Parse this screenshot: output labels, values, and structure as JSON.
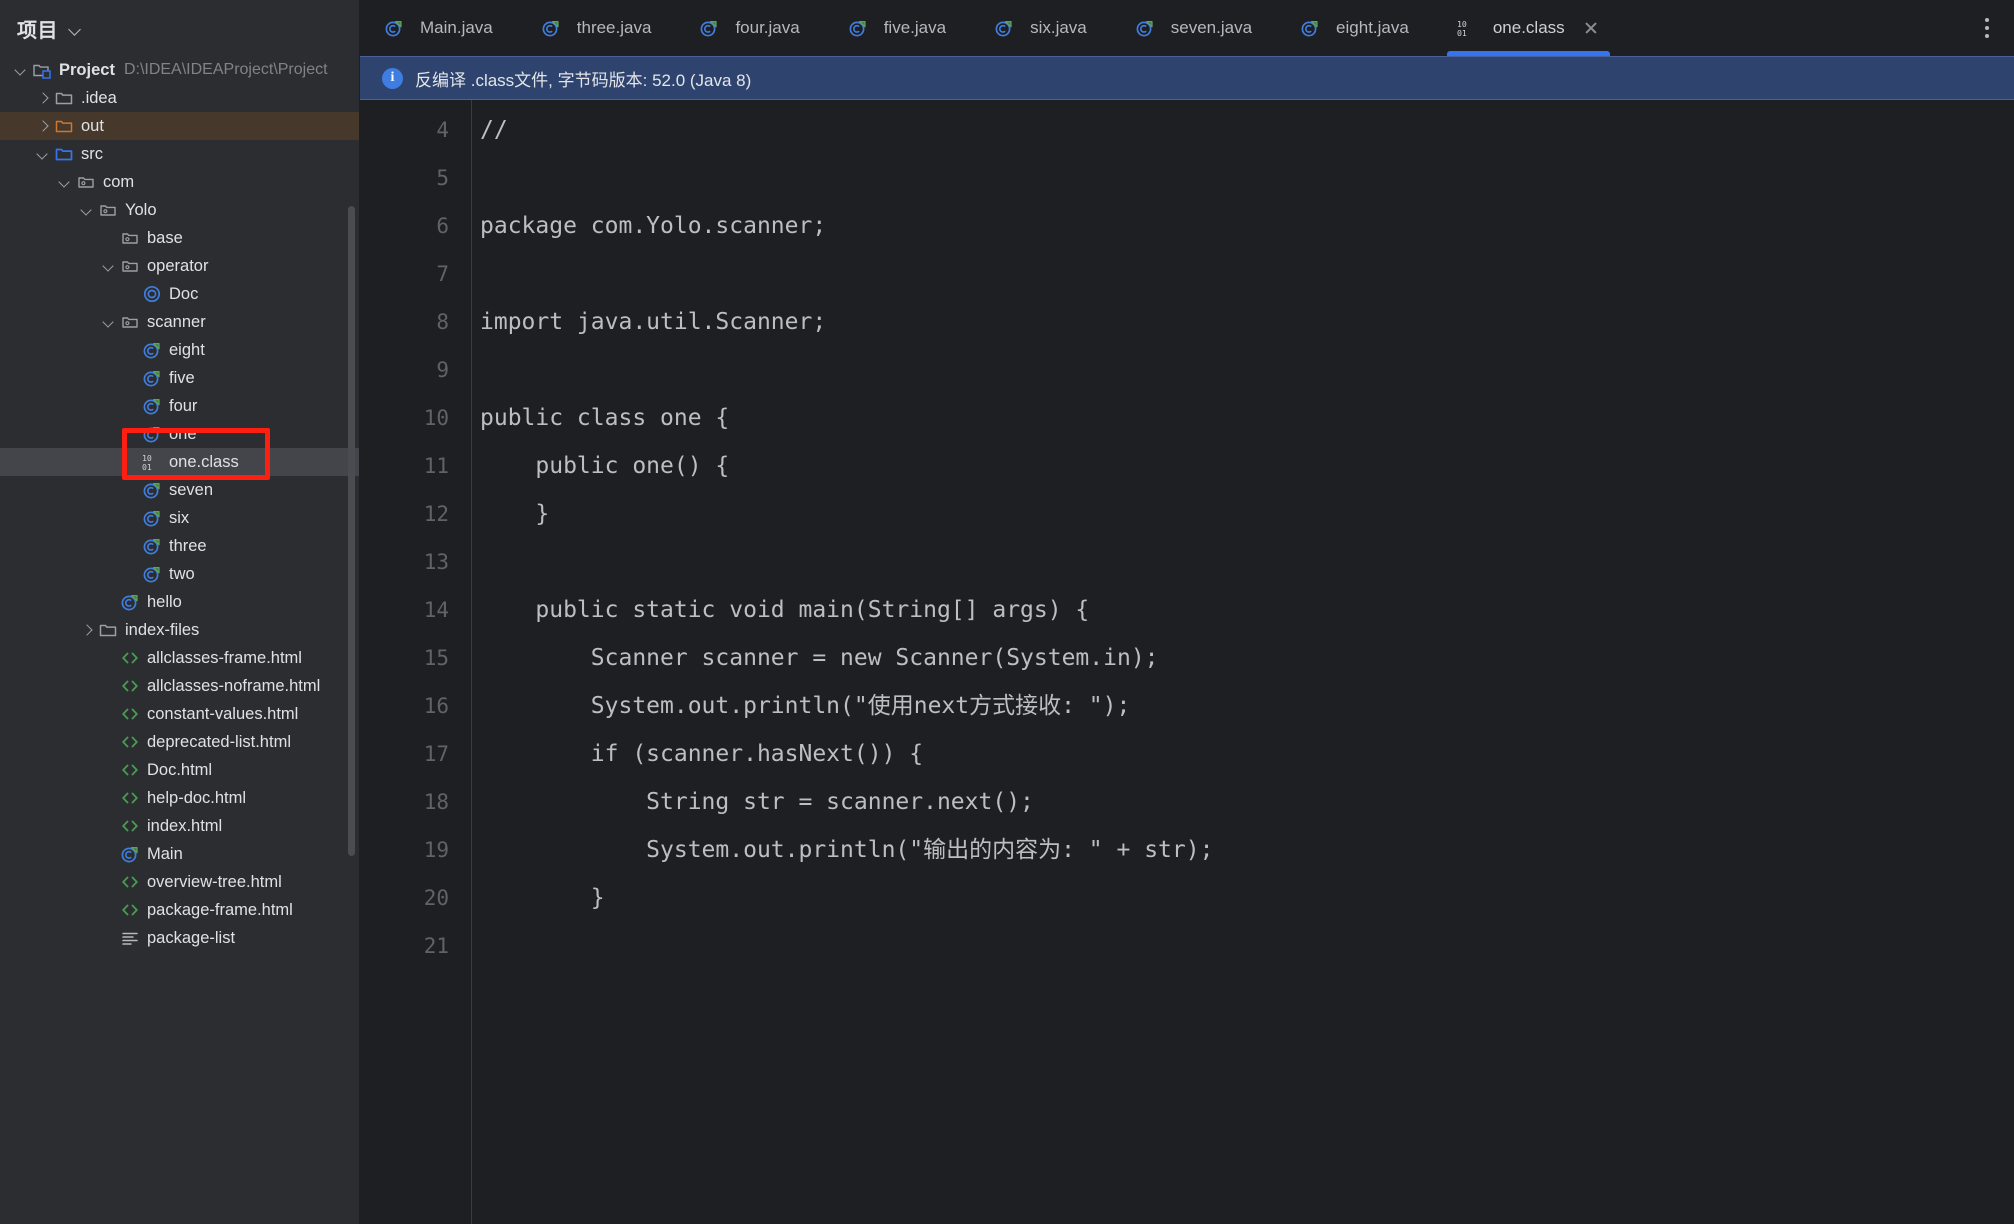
{
  "sidebar": {
    "title": "项目",
    "tree": [
      {
        "depth": 0,
        "twisty": "down",
        "icon": "project-folder-icon",
        "label": "Project",
        "bold": true,
        "sub": "D:\\IDEA\\IDEAProject\\Project",
        "sel": "none"
      },
      {
        "depth": 1,
        "twisty": "right",
        "icon": "folder-icon",
        "label": ".idea",
        "bold": false,
        "sub": "",
        "sel": "none"
      },
      {
        "depth": 1,
        "twisty": "right",
        "icon": "folder-orange-icon",
        "label": "out",
        "bold": false,
        "sub": "",
        "sel": "orange"
      },
      {
        "depth": 1,
        "twisty": "down",
        "icon": "folder-blue-icon",
        "label": "src",
        "bold": false,
        "sub": "",
        "sel": "none"
      },
      {
        "depth": 2,
        "twisty": "down",
        "icon": "package-folder-icon",
        "label": "com",
        "bold": false,
        "sub": "",
        "sel": "none"
      },
      {
        "depth": 3,
        "twisty": "down",
        "icon": "package-folder-icon",
        "label": "Yolo",
        "bold": false,
        "sub": "",
        "sel": "none"
      },
      {
        "depth": 4,
        "twisty": "none",
        "icon": "package-folder-icon",
        "label": "base",
        "bold": false,
        "sub": "",
        "sel": "none"
      },
      {
        "depth": 4,
        "twisty": "down",
        "icon": "package-folder-icon",
        "label": "operator",
        "bold": false,
        "sub": "",
        "sel": "none"
      },
      {
        "depth": 5,
        "twisty": "none",
        "icon": "java-class-icon",
        "label": "Doc",
        "bold": false,
        "sub": "",
        "sel": "none"
      },
      {
        "depth": 4,
        "twisty": "down",
        "icon": "package-folder-icon",
        "label": "scanner",
        "bold": false,
        "sub": "",
        "sel": "none"
      },
      {
        "depth": 5,
        "twisty": "none",
        "icon": "java-runnable-class-icon",
        "label": "eight",
        "bold": false,
        "sub": "",
        "sel": "none"
      },
      {
        "depth": 5,
        "twisty": "none",
        "icon": "java-runnable-class-icon",
        "label": "five",
        "bold": false,
        "sub": "",
        "sel": "none"
      },
      {
        "depth": 5,
        "twisty": "none",
        "icon": "java-runnable-class-icon",
        "label": "four",
        "bold": false,
        "sub": "",
        "sel": "none"
      },
      {
        "depth": 5,
        "twisty": "none",
        "icon": "java-runnable-class-icon",
        "label": "one",
        "bold": false,
        "sub": "",
        "sel": "none"
      },
      {
        "depth": 5,
        "twisty": "none",
        "icon": "binary-class-file-icon",
        "label": "one.class",
        "bold": false,
        "sub": "",
        "sel": "gray"
      },
      {
        "depth": 5,
        "twisty": "none",
        "icon": "java-runnable-class-icon",
        "label": "seven",
        "bold": false,
        "sub": "",
        "sel": "none"
      },
      {
        "depth": 5,
        "twisty": "none",
        "icon": "java-runnable-class-icon",
        "label": "six",
        "bold": false,
        "sub": "",
        "sel": "none"
      },
      {
        "depth": 5,
        "twisty": "none",
        "icon": "java-runnable-class-icon",
        "label": "three",
        "bold": false,
        "sub": "",
        "sel": "none"
      },
      {
        "depth": 5,
        "twisty": "none",
        "icon": "java-runnable-class-icon",
        "label": "two",
        "bold": false,
        "sub": "",
        "sel": "none"
      },
      {
        "depth": 4,
        "twisty": "none",
        "icon": "java-runnable-class-icon",
        "label": "hello",
        "bold": false,
        "sub": "",
        "sel": "none"
      },
      {
        "depth": 3,
        "twisty": "right",
        "icon": "folder-icon",
        "label": "index-files",
        "bold": false,
        "sub": "",
        "sel": "none"
      },
      {
        "depth": 4,
        "twisty": "none",
        "icon": "html-file-icon",
        "label": "allclasses-frame.html",
        "bold": false,
        "sub": "",
        "sel": "none"
      },
      {
        "depth": 4,
        "twisty": "none",
        "icon": "html-file-icon",
        "label": "allclasses-noframe.html",
        "bold": false,
        "sub": "",
        "sel": "none"
      },
      {
        "depth": 4,
        "twisty": "none",
        "icon": "html-file-icon",
        "label": "constant-values.html",
        "bold": false,
        "sub": "",
        "sel": "none"
      },
      {
        "depth": 4,
        "twisty": "none",
        "icon": "html-file-icon",
        "label": "deprecated-list.html",
        "bold": false,
        "sub": "",
        "sel": "none"
      },
      {
        "depth": 4,
        "twisty": "none",
        "icon": "html-file-icon",
        "label": "Doc.html",
        "bold": false,
        "sub": "",
        "sel": "none"
      },
      {
        "depth": 4,
        "twisty": "none",
        "icon": "html-file-icon",
        "label": "help-doc.html",
        "bold": false,
        "sub": "",
        "sel": "none"
      },
      {
        "depth": 4,
        "twisty": "none",
        "icon": "html-file-icon",
        "label": "index.html",
        "bold": false,
        "sub": "",
        "sel": "none"
      },
      {
        "depth": 4,
        "twisty": "none",
        "icon": "java-runnable-class-icon",
        "label": "Main",
        "bold": false,
        "sub": "",
        "sel": "none"
      },
      {
        "depth": 4,
        "twisty": "none",
        "icon": "html-file-icon",
        "label": "overview-tree.html",
        "bold": false,
        "sub": "",
        "sel": "none"
      },
      {
        "depth": 4,
        "twisty": "none",
        "icon": "html-file-icon",
        "label": "package-frame.html",
        "bold": false,
        "sub": "",
        "sel": "none"
      },
      {
        "depth": 4,
        "twisty": "none",
        "icon": "text-file-icon",
        "label": "package-list",
        "bold": false,
        "sub": "",
        "sel": "none"
      }
    ]
  },
  "tabs": [
    {
      "label": "Main.java",
      "icon": "java-runnable-class-icon",
      "active": false,
      "closable": false
    },
    {
      "label": "three.java",
      "icon": "java-runnable-class-icon",
      "active": false,
      "closable": false
    },
    {
      "label": "four.java",
      "icon": "java-runnable-class-icon",
      "active": false,
      "closable": false
    },
    {
      "label": "five.java",
      "icon": "java-runnable-class-icon",
      "active": false,
      "closable": false
    },
    {
      "label": "six.java",
      "icon": "java-runnable-class-icon",
      "active": false,
      "closable": false
    },
    {
      "label": "seven.java",
      "icon": "java-runnable-class-icon",
      "active": false,
      "closable": false
    },
    {
      "label": "eight.java",
      "icon": "java-runnable-class-icon",
      "active": false,
      "closable": false
    },
    {
      "label": "one.class",
      "icon": "binary-class-file-icon",
      "active": true,
      "closable": true
    }
  ],
  "notification": {
    "icon": "info-icon",
    "text": "反编译 .class文件, 字节码版本: 52.0 (Java 8)"
  },
  "editor": {
    "lines": [
      {
        "n": "4",
        "text": "//"
      },
      {
        "n": "5",
        "text": ""
      },
      {
        "n": "6",
        "text": "package com.Yolo.scanner;"
      },
      {
        "n": "7",
        "text": ""
      },
      {
        "n": "8",
        "text": "import java.util.Scanner;"
      },
      {
        "n": "9",
        "text": ""
      },
      {
        "n": "10",
        "text": "public class one {"
      },
      {
        "n": "11",
        "text": "    public one() {"
      },
      {
        "n": "12",
        "text": "    }"
      },
      {
        "n": "13",
        "text": ""
      },
      {
        "n": "14",
        "text": "    public static void main(String[] args) {"
      },
      {
        "n": "15",
        "text": "        Scanner scanner = new Scanner(System.in);"
      },
      {
        "n": "16",
        "text": "        System.out.println(\"使用next方式接收: \");"
      },
      {
        "n": "17",
        "text": "        if (scanner.hasNext()) {"
      },
      {
        "n": "18",
        "text": "            String str = scanner.next();"
      },
      {
        "n": "19",
        "text": "            System.out.println(\"输出的内容为: \" + str);"
      },
      {
        "n": "20",
        "text": "        }"
      },
      {
        "n": "21",
        "text": ""
      }
    ]
  },
  "colors": {
    "accent": "#3574f0",
    "annotation": "#ff1f10",
    "sidebar_bg": "#2b2d30",
    "editor_bg": "#1e1f22",
    "notification_bg": "#2e436e"
  }
}
